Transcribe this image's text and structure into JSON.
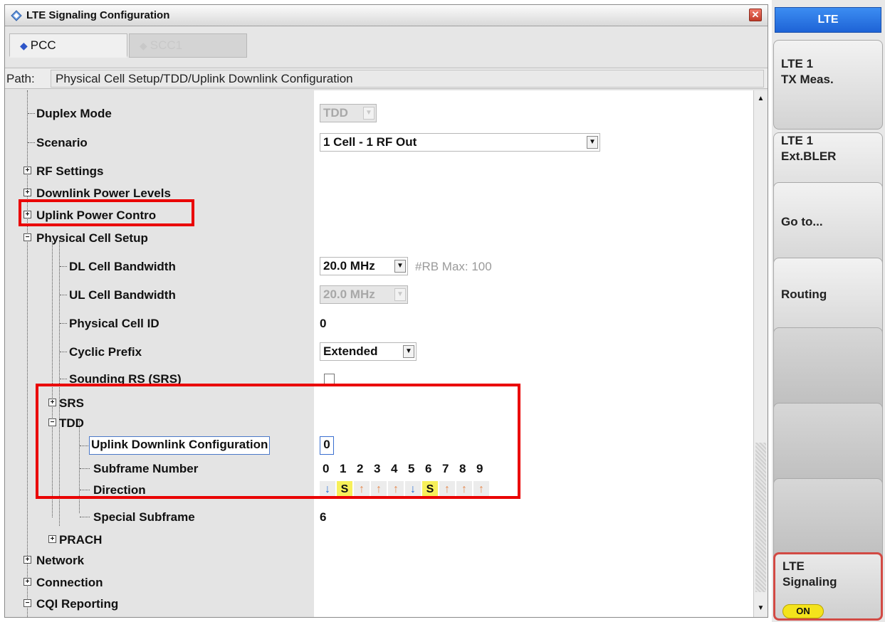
{
  "window": {
    "title": "LTE Signaling Configuration",
    "close_symbol": "✕",
    "tabs": [
      {
        "label": "PCC",
        "active": true
      },
      {
        "label": "SCC1",
        "active": false
      }
    ],
    "path_label": "Path:",
    "path_value": "Physical Cell Setup/TDD/Uplink Downlink Configuration"
  },
  "tree": {
    "duplex_mode": {
      "label": "Duplex Mode",
      "value": "TDD"
    },
    "scenario": {
      "label": "Scenario",
      "value": "1 Cell - 1 RF Out"
    },
    "rf_settings": {
      "label": "RF Settings"
    },
    "downlink_power_levels": {
      "label": "Downlink Power Levels"
    },
    "uplink_power_control": {
      "label": "Uplink Power Contro"
    },
    "physical_cell_setup": {
      "label": "Physical Cell Setup"
    },
    "dl_cell_bandwidth": {
      "label": "DL Cell Bandwidth",
      "value": "20.0 MHz",
      "rb_max_text": "#RB Max:  100"
    },
    "ul_cell_bandwidth": {
      "label": "UL Cell Bandwidth",
      "value": "20.0 MHz"
    },
    "physical_cell_id": {
      "label": "Physical Cell ID",
      "value": "0"
    },
    "cyclic_prefix": {
      "label": "Cyclic Prefix",
      "value": "Extended"
    },
    "sounding_rs": {
      "label": "Sounding RS (SRS)",
      "checked": false
    },
    "srs": {
      "label": "SRS"
    },
    "tdd": {
      "label": "TDD"
    },
    "ul_dl_config": {
      "label": "Uplink Downlink Configuration",
      "value": "0"
    },
    "subframe_number": {
      "label": "Subframe Number",
      "numbers": [
        "0",
        "1",
        "2",
        "3",
        "4",
        "5",
        "6",
        "7",
        "8",
        "9"
      ]
    },
    "direction": {
      "label": "Direction",
      "cells": [
        "↓",
        "S",
        "↑",
        "↑",
        "↑",
        "↓",
        "S",
        "↑",
        "↑",
        "↑"
      ]
    },
    "special_subframe": {
      "label": "Special Subframe",
      "value": "6"
    },
    "prach": {
      "label": "PRACH"
    },
    "network": {
      "label": "Network"
    },
    "connection": {
      "label": "Connection"
    },
    "cqi_reporting": {
      "label": "CQI Reporting"
    }
  },
  "panel": {
    "header": "LTE",
    "softkeys": [
      {
        "label": "LTE 1\nTX Meas."
      },
      {
        "label": "LTE 1\nExt.BLER"
      },
      {
        "label": "Go to..."
      },
      {
        "label": "Routing"
      },
      {
        "label": ""
      },
      {
        "label": ""
      },
      {
        "label": ""
      },
      {
        "label": "LTE\nSignaling",
        "badge": "ON"
      }
    ]
  },
  "colors": {
    "highlight_red": "#ea0000",
    "accent_blue": "#1e63d6",
    "downlink_arrow": "#2b6fd6",
    "uplink_arrow": "#e58a52",
    "special_cell": "#f7f05a",
    "on_badge": "#f4e31c"
  }
}
